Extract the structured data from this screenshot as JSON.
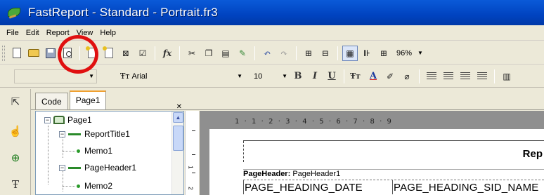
{
  "window": {
    "title": "FastReport - Standard - Portrait.fr3"
  },
  "menu": [
    "File",
    "Edit",
    "Report",
    "View",
    "Help"
  ],
  "toolbar": {
    "zoom": "96%",
    "font_name": "Arial",
    "font_size": "10",
    "style_value": "",
    "fx": "fx",
    "bold": "B",
    "italic": "I",
    "underline": "U"
  },
  "tabs": [
    {
      "label": "Code",
      "active": false
    },
    {
      "label": "Page1",
      "active": true
    }
  ],
  "tree": [
    {
      "label": "Page1",
      "level": 0,
      "type": "page",
      "expander": "−"
    },
    {
      "label": "ReportTitle1",
      "level": 1,
      "type": "band",
      "expander": "−"
    },
    {
      "label": "Memo1",
      "level": 2,
      "type": "memo"
    },
    {
      "label": "PageHeader1",
      "level": 1,
      "type": "band",
      "expander": "−"
    },
    {
      "label": "Memo2",
      "level": 2,
      "type": "memo"
    }
  ],
  "ruler": {
    "marks": "1  ·  1  ·  2  ·  3  ·  4  ·  5  ·  6  ·  7  ·  8  ·  9"
  },
  "vruler": {
    "marks": [
      "1",
      "2"
    ]
  },
  "designer": {
    "title_text": "Rep",
    "page_header_label_bold": "PageHeader:",
    "page_header_label": " PageHeader1",
    "fields": [
      "PAGE_HEADING_DATE",
      "PAGE_HEADING_SID_NAME"
    ]
  },
  "colors": {
    "titlebar": "#0a5ad8",
    "highlight": "#e01010",
    "tab_accent": "#f0a030"
  }
}
